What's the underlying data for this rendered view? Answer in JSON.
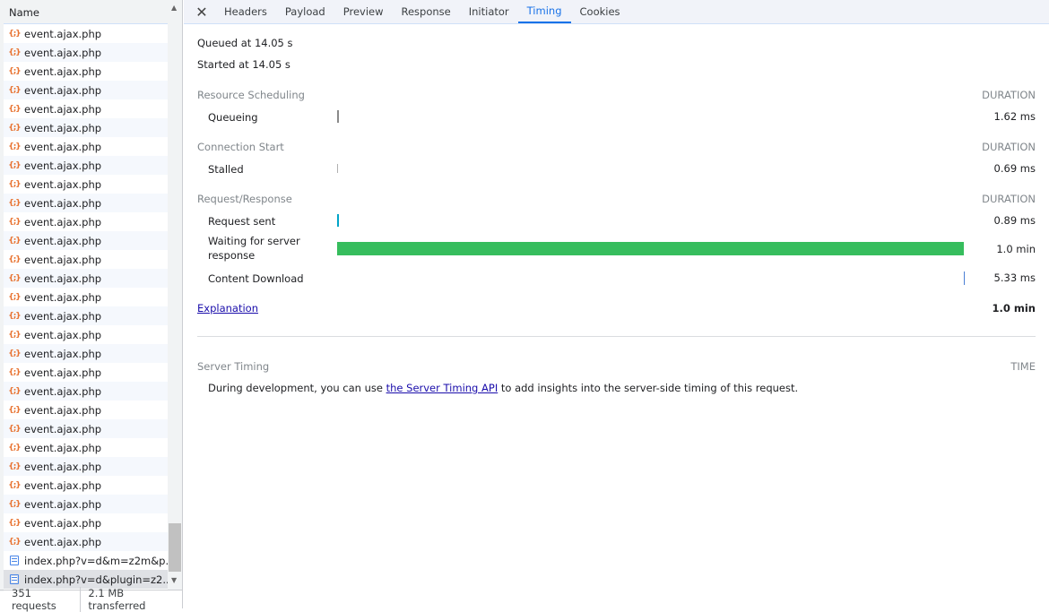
{
  "left_panel": {
    "header": "Name",
    "rows": [
      {
        "name": "event.ajax.php",
        "type": "xhr"
      },
      {
        "name": "event.ajax.php",
        "type": "xhr"
      },
      {
        "name": "event.ajax.php",
        "type": "xhr"
      },
      {
        "name": "event.ajax.php",
        "type": "xhr"
      },
      {
        "name": "event.ajax.php",
        "type": "xhr"
      },
      {
        "name": "event.ajax.php",
        "type": "xhr"
      },
      {
        "name": "event.ajax.php",
        "type": "xhr"
      },
      {
        "name": "event.ajax.php",
        "type": "xhr"
      },
      {
        "name": "event.ajax.php",
        "type": "xhr"
      },
      {
        "name": "event.ajax.php",
        "type": "xhr"
      },
      {
        "name": "event.ajax.php",
        "type": "xhr"
      },
      {
        "name": "event.ajax.php",
        "type": "xhr"
      },
      {
        "name": "event.ajax.php",
        "type": "xhr"
      },
      {
        "name": "event.ajax.php",
        "type": "xhr"
      },
      {
        "name": "event.ajax.php",
        "type": "xhr"
      },
      {
        "name": "event.ajax.php",
        "type": "xhr"
      },
      {
        "name": "event.ajax.php",
        "type": "xhr"
      },
      {
        "name": "event.ajax.php",
        "type": "xhr"
      },
      {
        "name": "event.ajax.php",
        "type": "xhr"
      },
      {
        "name": "event.ajax.php",
        "type": "xhr"
      },
      {
        "name": "event.ajax.php",
        "type": "xhr"
      },
      {
        "name": "event.ajax.php",
        "type": "xhr"
      },
      {
        "name": "event.ajax.php",
        "type": "xhr"
      },
      {
        "name": "event.ajax.php",
        "type": "xhr"
      },
      {
        "name": "event.ajax.php",
        "type": "xhr"
      },
      {
        "name": "event.ajax.php",
        "type": "xhr"
      },
      {
        "name": "event.ajax.php",
        "type": "xhr"
      },
      {
        "name": "event.ajax.php",
        "type": "xhr"
      },
      {
        "name": "index.php?v=d&m=z2m&p...",
        "type": "doc"
      },
      {
        "name": "index.php?v=d&plugin=z2...",
        "type": "doc",
        "selected": true
      }
    ],
    "footer": {
      "requests": "351 requests",
      "transferred": "2.1 MB transferred"
    }
  },
  "tabs": [
    "Headers",
    "Payload",
    "Preview",
    "Response",
    "Initiator",
    "Timing",
    "Cookies"
  ],
  "active_tab": "Timing",
  "timing": {
    "queued": "Queued at 14.05 s",
    "started": "Started at 14.05 s",
    "duration_label": "DURATION",
    "sections": [
      {
        "title": "Resource Scheduling",
        "items": [
          {
            "label": "Queueing",
            "value": "1.62 ms",
            "color": "#8a8a8a"
          }
        ]
      },
      {
        "title": "Connection Start",
        "items": [
          {
            "label": "Stalled",
            "value": "0.69 ms",
            "color": "#b0b0b0"
          }
        ]
      },
      {
        "title": "Request/Response",
        "items": [
          {
            "label": "Request sent",
            "value": "0.89 ms",
            "color": "#00a4c8"
          },
          {
            "label": "Waiting for server response",
            "value": "1.0 min",
            "color": "#36bd5d"
          },
          {
            "label": "Content Download",
            "value": "5.33 ms",
            "color": "#4a7fd4"
          }
        ]
      }
    ],
    "explanation": "Explanation",
    "total": "1.0 min"
  },
  "server_timing": {
    "title": "Server Timing",
    "time_label": "TIME",
    "text_before": "During development, you can use ",
    "link": "the Server Timing API",
    "text_after": " to add insights into the server-side timing of this request."
  }
}
